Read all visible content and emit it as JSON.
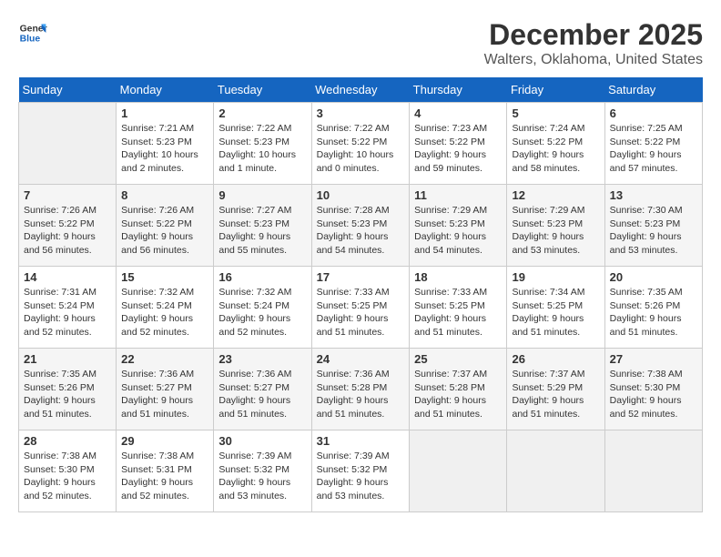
{
  "header": {
    "logo_general": "General",
    "logo_blue": "Blue",
    "title": "December 2025",
    "subtitle": "Walters, Oklahoma, United States"
  },
  "calendar": {
    "days_of_week": [
      "Sunday",
      "Monday",
      "Tuesday",
      "Wednesday",
      "Thursday",
      "Friday",
      "Saturday"
    ],
    "weeks": [
      [
        {
          "day": "",
          "info": ""
        },
        {
          "day": "1",
          "info": "Sunrise: 7:21 AM\nSunset: 5:23 PM\nDaylight: 10 hours\nand 2 minutes."
        },
        {
          "day": "2",
          "info": "Sunrise: 7:22 AM\nSunset: 5:23 PM\nDaylight: 10 hours\nand 1 minute."
        },
        {
          "day": "3",
          "info": "Sunrise: 7:22 AM\nSunset: 5:22 PM\nDaylight: 10 hours\nand 0 minutes."
        },
        {
          "day": "4",
          "info": "Sunrise: 7:23 AM\nSunset: 5:22 PM\nDaylight: 9 hours\nand 59 minutes."
        },
        {
          "day": "5",
          "info": "Sunrise: 7:24 AM\nSunset: 5:22 PM\nDaylight: 9 hours\nand 58 minutes."
        },
        {
          "day": "6",
          "info": "Sunrise: 7:25 AM\nSunset: 5:22 PM\nDaylight: 9 hours\nand 57 minutes."
        }
      ],
      [
        {
          "day": "7",
          "info": "Sunrise: 7:26 AM\nSunset: 5:22 PM\nDaylight: 9 hours\nand 56 minutes."
        },
        {
          "day": "8",
          "info": "Sunrise: 7:26 AM\nSunset: 5:22 PM\nDaylight: 9 hours\nand 56 minutes."
        },
        {
          "day": "9",
          "info": "Sunrise: 7:27 AM\nSunset: 5:23 PM\nDaylight: 9 hours\nand 55 minutes."
        },
        {
          "day": "10",
          "info": "Sunrise: 7:28 AM\nSunset: 5:23 PM\nDaylight: 9 hours\nand 54 minutes."
        },
        {
          "day": "11",
          "info": "Sunrise: 7:29 AM\nSunset: 5:23 PM\nDaylight: 9 hours\nand 54 minutes."
        },
        {
          "day": "12",
          "info": "Sunrise: 7:29 AM\nSunset: 5:23 PM\nDaylight: 9 hours\nand 53 minutes."
        },
        {
          "day": "13",
          "info": "Sunrise: 7:30 AM\nSunset: 5:23 PM\nDaylight: 9 hours\nand 53 minutes."
        }
      ],
      [
        {
          "day": "14",
          "info": "Sunrise: 7:31 AM\nSunset: 5:24 PM\nDaylight: 9 hours\nand 52 minutes."
        },
        {
          "day": "15",
          "info": "Sunrise: 7:32 AM\nSunset: 5:24 PM\nDaylight: 9 hours\nand 52 minutes."
        },
        {
          "day": "16",
          "info": "Sunrise: 7:32 AM\nSunset: 5:24 PM\nDaylight: 9 hours\nand 52 minutes."
        },
        {
          "day": "17",
          "info": "Sunrise: 7:33 AM\nSunset: 5:25 PM\nDaylight: 9 hours\nand 51 minutes."
        },
        {
          "day": "18",
          "info": "Sunrise: 7:33 AM\nSunset: 5:25 PM\nDaylight: 9 hours\nand 51 minutes."
        },
        {
          "day": "19",
          "info": "Sunrise: 7:34 AM\nSunset: 5:25 PM\nDaylight: 9 hours\nand 51 minutes."
        },
        {
          "day": "20",
          "info": "Sunrise: 7:35 AM\nSunset: 5:26 PM\nDaylight: 9 hours\nand 51 minutes."
        }
      ],
      [
        {
          "day": "21",
          "info": "Sunrise: 7:35 AM\nSunset: 5:26 PM\nDaylight: 9 hours\nand 51 minutes."
        },
        {
          "day": "22",
          "info": "Sunrise: 7:36 AM\nSunset: 5:27 PM\nDaylight: 9 hours\nand 51 minutes."
        },
        {
          "day": "23",
          "info": "Sunrise: 7:36 AM\nSunset: 5:27 PM\nDaylight: 9 hours\nand 51 minutes."
        },
        {
          "day": "24",
          "info": "Sunrise: 7:36 AM\nSunset: 5:28 PM\nDaylight: 9 hours\nand 51 minutes."
        },
        {
          "day": "25",
          "info": "Sunrise: 7:37 AM\nSunset: 5:28 PM\nDaylight: 9 hours\nand 51 minutes."
        },
        {
          "day": "26",
          "info": "Sunrise: 7:37 AM\nSunset: 5:29 PM\nDaylight: 9 hours\nand 51 minutes."
        },
        {
          "day": "27",
          "info": "Sunrise: 7:38 AM\nSunset: 5:30 PM\nDaylight: 9 hours\nand 52 minutes."
        }
      ],
      [
        {
          "day": "28",
          "info": "Sunrise: 7:38 AM\nSunset: 5:30 PM\nDaylight: 9 hours\nand 52 minutes."
        },
        {
          "day": "29",
          "info": "Sunrise: 7:38 AM\nSunset: 5:31 PM\nDaylight: 9 hours\nand 52 minutes."
        },
        {
          "day": "30",
          "info": "Sunrise: 7:39 AM\nSunset: 5:32 PM\nDaylight: 9 hours\nand 53 minutes."
        },
        {
          "day": "31",
          "info": "Sunrise: 7:39 AM\nSunset: 5:32 PM\nDaylight: 9 hours\nand 53 minutes."
        },
        {
          "day": "",
          "info": ""
        },
        {
          "day": "",
          "info": ""
        },
        {
          "day": "",
          "info": ""
        }
      ]
    ]
  }
}
